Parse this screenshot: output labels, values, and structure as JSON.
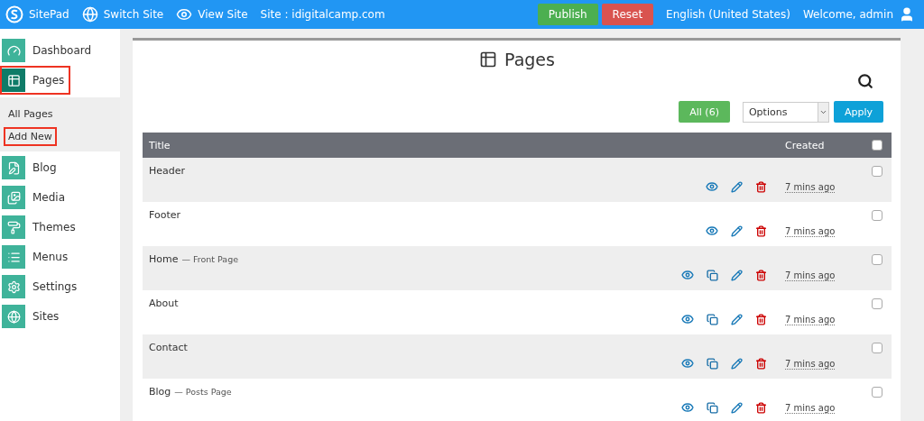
{
  "topbar": {
    "brand": "SitePad",
    "switch_site": "Switch Site",
    "view_site": "View Site",
    "site": "Site : idigitalcamp.com",
    "publish": "Publish",
    "reset": "Reset",
    "language": "English (United States)",
    "welcome": "Welcome, admin"
  },
  "sidebar": {
    "items": [
      {
        "kind": "dashboard",
        "label": "Dashboard",
        "selected": false,
        "highlighted": false
      },
      {
        "kind": "pages",
        "label": "Pages",
        "selected": true,
        "highlighted": true,
        "children": [
          {
            "label": "All Pages",
            "highlighted": false
          },
          {
            "label": "Add New",
            "highlighted": true
          }
        ]
      },
      {
        "kind": "blog",
        "label": "Blog",
        "selected": false,
        "highlighted": false
      },
      {
        "kind": "media",
        "label": "Media",
        "selected": false,
        "highlighted": false
      },
      {
        "kind": "themes",
        "label": "Themes",
        "selected": false,
        "highlighted": false
      },
      {
        "kind": "menus",
        "label": "Menus",
        "selected": false,
        "highlighted": false
      },
      {
        "kind": "settings",
        "label": "Settings",
        "selected": false,
        "highlighted": false
      },
      {
        "kind": "sites",
        "label": "Sites",
        "selected": false,
        "highlighted": false
      }
    ]
  },
  "main": {
    "title": "Pages",
    "filter": "All (6)",
    "bulk_select": "Options",
    "apply": "Apply",
    "table": {
      "columns": [
        "Title",
        "Created"
      ],
      "select_all_checked": false,
      "rows": [
        {
          "title": "Header",
          "actions": [
            {
              "kind": "view"
            },
            {
              "kind": "edit"
            },
            {
              "kind": "delete"
            }
          ],
          "created": "7 mins ago",
          "checked": false
        },
        {
          "title": "Footer",
          "actions": [
            {
              "kind": "view"
            },
            {
              "kind": "edit"
            },
            {
              "kind": "delete"
            }
          ],
          "created": "7 mins ago",
          "checked": false
        },
        {
          "title": "Home",
          "suffix": "— Front Page",
          "actions": [
            {
              "kind": "view"
            },
            {
              "kind": "copy"
            },
            {
              "kind": "edit"
            },
            {
              "kind": "delete"
            }
          ],
          "created": "7 mins ago",
          "checked": false
        },
        {
          "title": "About",
          "actions": [
            {
              "kind": "view"
            },
            {
              "kind": "copy"
            },
            {
              "kind": "edit"
            },
            {
              "kind": "delete"
            }
          ],
          "created": "7 mins ago",
          "checked": false
        },
        {
          "title": "Contact",
          "actions": [
            {
              "kind": "view"
            },
            {
              "kind": "copy"
            },
            {
              "kind": "edit"
            },
            {
              "kind": "delete"
            }
          ],
          "created": "7 mins ago",
          "checked": false
        },
        {
          "title": "Blog",
          "suffix": "— Posts Page",
          "actions": [
            {
              "kind": "view"
            },
            {
              "kind": "copy"
            },
            {
              "kind": "edit"
            },
            {
              "kind": "delete"
            }
          ],
          "created": "7 mins ago",
          "checked": false
        }
      ]
    }
  }
}
